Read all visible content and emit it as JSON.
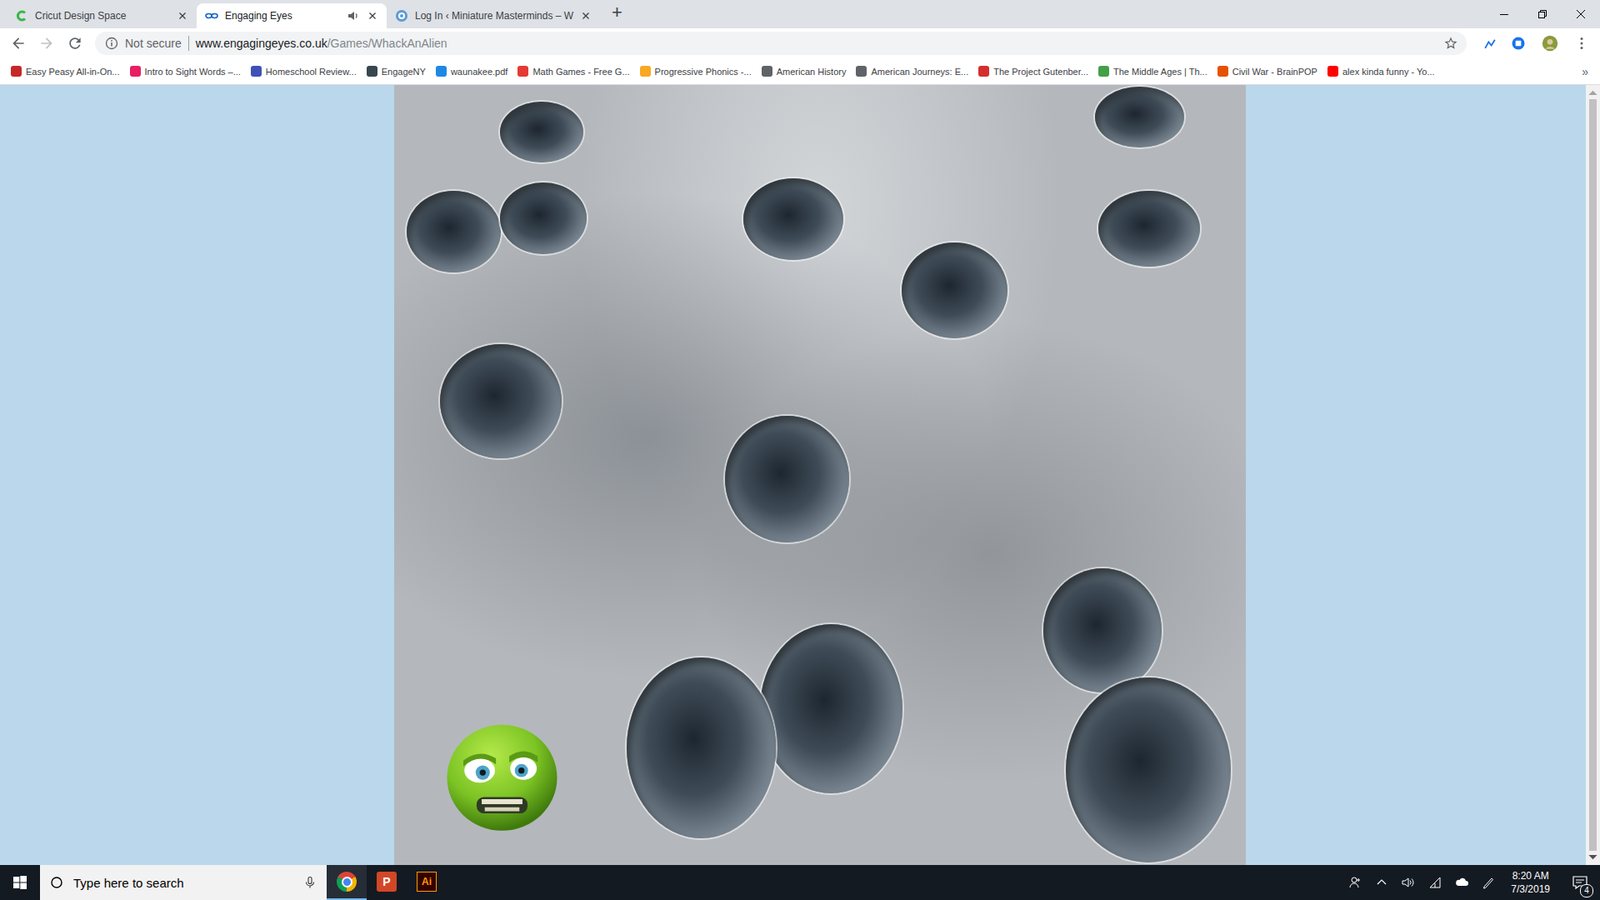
{
  "tabs": [
    {
      "label": "Cricut Design Space",
      "selected": false,
      "audio": false,
      "kind": "cricut"
    },
    {
      "label": "Engaging Eyes",
      "selected": true,
      "audio": true,
      "kind": "eyes"
    },
    {
      "label": "Log In ‹ Miniature Masterminds – W",
      "selected": false,
      "audio": false,
      "kind": "wordpress"
    }
  ],
  "new_tab": "+",
  "address_bar": {
    "security": "Not secure",
    "host": "www.engagingeyes.co.uk",
    "path": "/Games/WhackAnAlien",
    "bookmarked": false
  },
  "bookmarks": [
    {
      "label": "Easy Peasy All-in-On...",
      "color": "#c62828"
    },
    {
      "label": "Intro to Sight Words –...",
      "color": "#e91e63"
    },
    {
      "label": "Homeschool Review...",
      "color": "#3f51b5"
    },
    {
      "label": "EngageNY",
      "color": "#37474f"
    },
    {
      "label": "waunakee.pdf",
      "color": "#1e88e5"
    },
    {
      "label": "Math Games - Free G...",
      "color": "#e53935"
    },
    {
      "label": "Progressive Phonics -...",
      "color": "#f9a825"
    },
    {
      "label": "American History",
      "color": "#5f6368"
    },
    {
      "label": "American Journeys: E...",
      "color": "#5f6368"
    },
    {
      "label": "The Project Gutenber...",
      "color": "#d32f2f"
    },
    {
      "label": "The Middle Ages | Th...",
      "color": "#43a047"
    },
    {
      "label": "Civil War - BrainPOP",
      "color": "#e65100"
    },
    {
      "label": "alex kinda funny - Yo...",
      "color": "#ff0000"
    }
  ],
  "bookmarks_overflow": "»",
  "taskbar": {
    "search_placeholder": "Type here to search",
    "apps": [
      {
        "kind": "chrome",
        "label": "",
        "active": true
      },
      {
        "kind": "powerpoint",
        "label": "P",
        "active": false
      },
      {
        "kind": "illustrator",
        "label": "Ai",
        "active": false
      }
    ],
    "time": "8:20 AM",
    "date": "7/3/2019",
    "notifications": "4"
  }
}
